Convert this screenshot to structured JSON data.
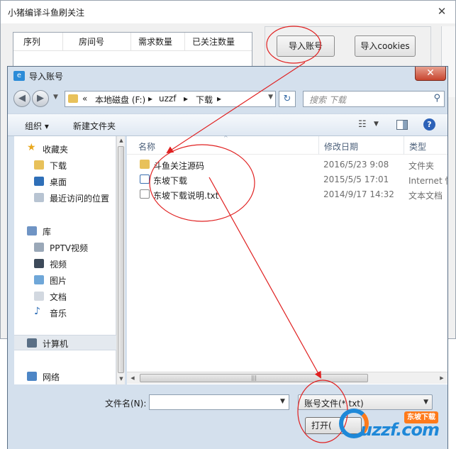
{
  "background_window": {
    "title": "小猪编译斗鱼刷关注",
    "close_glyph": "✕",
    "table_headers": [
      "序列",
      "房间号",
      "需求数量",
      "已关注数量"
    ],
    "import_account_label": "导入账号",
    "import_cookies_label": "导入cookies"
  },
  "dialog": {
    "title": "导入账号",
    "close_glyph": "✕",
    "nav": {
      "back_glyph": "◀",
      "forward_glyph": "▶",
      "history_glyph": "▼",
      "path": [
        "本地磁盘 (F:)",
        "uzzf",
        "下载"
      ],
      "path_prefix": "«",
      "path_separator": "▸",
      "path_dropdown": "▼",
      "refresh_glyph": "↻",
      "search_placeholder": "搜索 下载"
    },
    "toolbar": {
      "organize_label": "组织 ▾",
      "new_folder_label": "新建文件夹",
      "view_glyph": "☷",
      "view_drop": "▼",
      "help_glyph": "?"
    },
    "nav_pane": {
      "items": [
        {
          "label": "收藏夹",
          "icon": "star-icon"
        },
        {
          "label": "下载",
          "icon": "download-folder-icon"
        },
        {
          "label": "桌面",
          "icon": "desktop-icon"
        },
        {
          "label": "最近访问的位置",
          "icon": "recent-places-icon"
        },
        {
          "label": "库",
          "icon": "libraries-icon"
        },
        {
          "label": "PPTV视频",
          "icon": "video-library-icon"
        },
        {
          "label": "视频",
          "icon": "video-library-icon"
        },
        {
          "label": "图片",
          "icon": "pictures-library-icon"
        },
        {
          "label": "文档",
          "icon": "documents-library-icon"
        },
        {
          "label": "音乐",
          "icon": "music-library-icon"
        },
        {
          "label": "计算机",
          "icon": "computer-icon"
        },
        {
          "label": "网络",
          "icon": "network-icon"
        }
      ],
      "scroll_up": "▲",
      "scroll_down": "▼"
    },
    "columns": [
      "名称",
      "修改日期",
      "类型"
    ],
    "sort_glyph": "^",
    "files": [
      {
        "name": "斗鱼关注源码",
        "date": "2016/5/23 9:08",
        "type": "文件夹",
        "icon": "folder-icon"
      },
      {
        "name": "东坡下载",
        "date": "2015/5/5 17:01",
        "type": "Internet 快",
        "icon": "internet-shortcut-icon"
      },
      {
        "name": "东坡下载说明.txt",
        "date": "2014/9/17 14:32",
        "type": "文本文档",
        "icon": "text-file-icon"
      }
    ],
    "hscroll": {
      "left": "◀",
      "right": "▶",
      "grip": "|||"
    },
    "filename_label": "文件名(N):",
    "filename_value": "",
    "filename_drop": "▼",
    "filetype_value": "账号文件(*.txt)",
    "filetype_drop": "▼",
    "open_label": "打开("
  },
  "watermark": {
    "badge": "东坡下载",
    "logo": "uzzf.com"
  },
  "colors": {
    "annotation": "#e02020",
    "watermark_blue": "#1e88d8",
    "watermark_orange": "#ff7a1a"
  }
}
